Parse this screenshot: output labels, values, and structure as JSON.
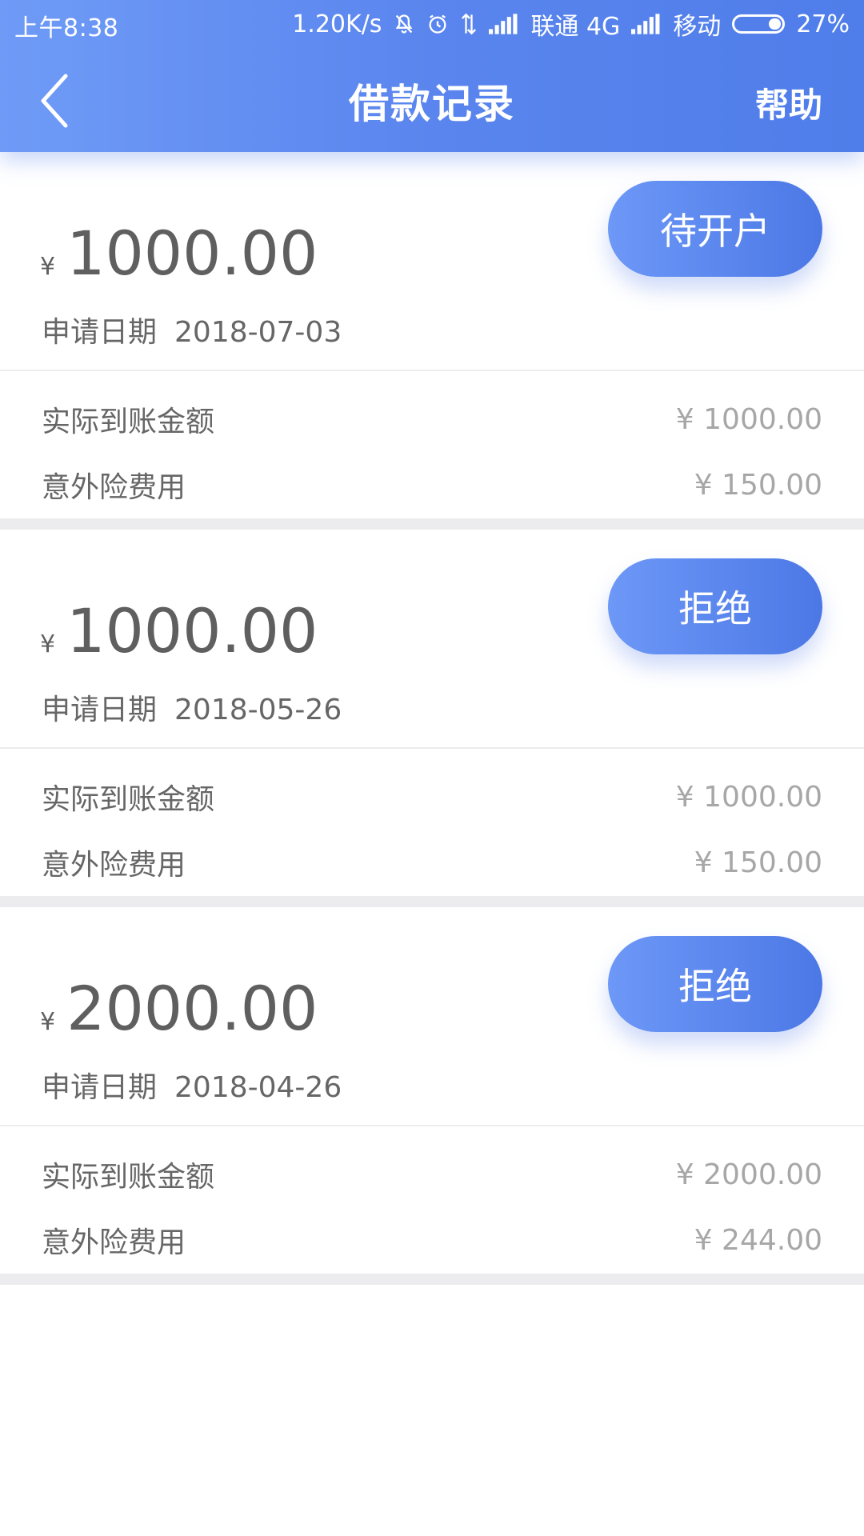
{
  "status_bar": {
    "time": "上午8:38",
    "speed": "1.20K/s",
    "carrier1": "联通 4G",
    "carrier2": "移动",
    "battery": "27%",
    "battery_level": 0.27
  },
  "nav": {
    "title": "借款记录",
    "help": "帮助"
  },
  "records": [
    {
      "currency": "¥",
      "amount": "1000.00",
      "date_label": "申请日期",
      "date": "2018-07-03",
      "status": "待开户",
      "received_label": "实际到账金额",
      "received_value": "¥ 1000.00",
      "insurance_label": "意外险费用",
      "insurance_value": "¥ 150.00"
    },
    {
      "currency": "¥",
      "amount": "1000.00",
      "date_label": "申请日期",
      "date": "2018-05-26",
      "status": "拒绝",
      "received_label": "实际到账金额",
      "received_value": "¥ 1000.00",
      "insurance_label": "意外险费用",
      "insurance_value": "¥ 150.00"
    },
    {
      "currency": "¥",
      "amount": "2000.00",
      "date_label": "申请日期",
      "date": "2018-04-26",
      "status": "拒绝",
      "received_label": "实际到账金额",
      "received_value": "¥ 2000.00",
      "insurance_label": "意外险费用",
      "insurance_value": "¥ 244.00"
    }
  ],
  "colors": {
    "accent": "#5a85ee",
    "divider": "#ececee"
  }
}
